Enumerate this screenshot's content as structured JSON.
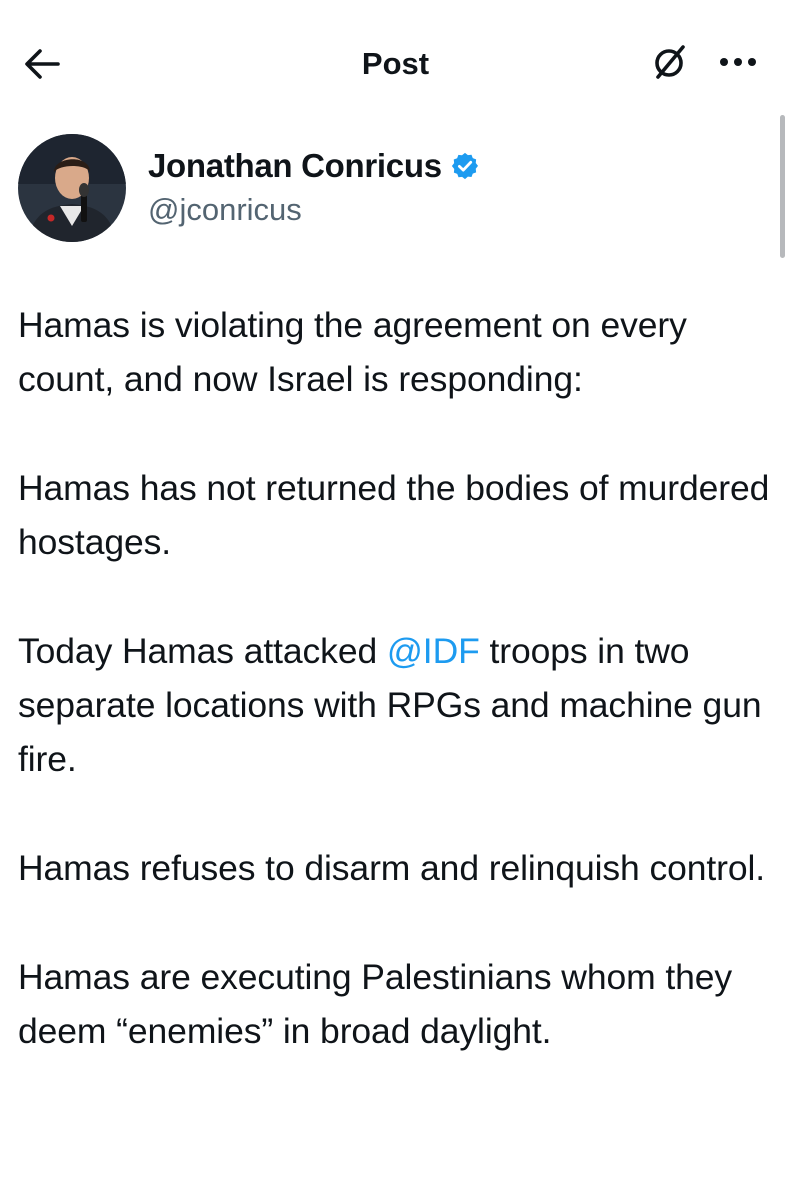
{
  "header": {
    "title": "Post",
    "back_icon": "arrow-left-icon",
    "grok_icon": "grok-icon",
    "more_icon": "more-horizontal-icon"
  },
  "author": {
    "display_name": "Jonathan Conricus",
    "handle": "@jconricus",
    "verified": true,
    "verified_color": "#1d9bf0",
    "avatar_icon": "avatar-photo"
  },
  "tweet": {
    "p1": "Hamas is violating the agreement on every count, and now Israel is responding:",
    "p2": "Hamas has not returned the bodies of murdered hostages.",
    "p3_before": "Today Hamas attacked ",
    "p3_mention": "@IDF",
    "p3_after": " troops in two separate locations with RPGs and machine gun fire.",
    "p4": "Hamas refuses to disarm and relinquish control.",
    "p5": "Hamas are executing Palestinians whom they deem “enemies” in broad daylight."
  },
  "colors": {
    "text": "#0f1419",
    "secondary_text": "#536471",
    "link": "#1d9bf0"
  }
}
